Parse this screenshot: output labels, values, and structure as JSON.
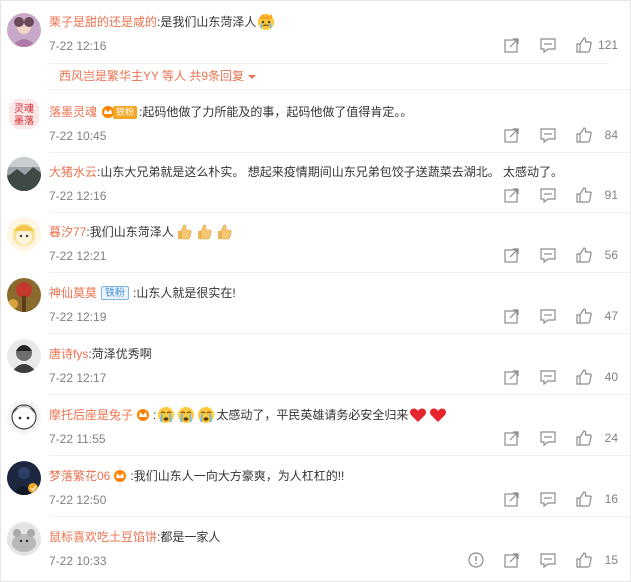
{
  "comments": [
    {
      "user": "栗子是甜的还是咸的",
      "text": "是我们山东菏泽人",
      "time": "7-22 12:16",
      "likes": "121"
    },
    {
      "user": "落墨灵魂",
      "badge": "铁粉",
      "text": "起码他做了力所能及的事，起码他做了值得肯定。。",
      "time": "7-22 10:45",
      "likes": "84"
    },
    {
      "user": "大猪水云",
      "text": "山东大兄弟就是这么朴实。 想起来疫情期间山东兄弟包饺子送蔬菜去湖北。 太感动了。",
      "time": "7-22 12:16",
      "likes": "91"
    },
    {
      "user": "暮汐77",
      "text": "我们山东菏泽人",
      "time": "7-22 12:21",
      "likes": "56"
    },
    {
      "user": "神仙莫莫",
      "badge": "铁粉",
      "text": "山东人就是很实在!",
      "time": "7-22 12:19",
      "likes": "47"
    },
    {
      "user": "唐诗fys",
      "text": "菏泽优秀啊",
      "time": "7-22 12:17",
      "likes": "40"
    },
    {
      "user": "摩托后座是兔子",
      "text": "太感动了，平民英雄请务必安全归来",
      "time": "7-22 11:55",
      "likes": "24"
    },
    {
      "user": "梦落繁花06",
      "text": "我们山东人一向大方豪爽，为人杠杠的!!",
      "time": "7-22 12:50",
      "likes": "16"
    },
    {
      "user": "鼠标喜欢吃土豆馅饼",
      "text": "都是一家人",
      "time": "7-22 10:33",
      "likes": "15"
    }
  ],
  "replies_summary": {
    "name": "西风岂是繁华主YY",
    "text": "等人 共9条回复"
  },
  "icons": {
    "share": "share-icon",
    "comment": "comment-icon",
    "like": "thumbs-up-icon",
    "report": "report-icon"
  },
  "colors": {
    "username": "#eb7350",
    "meta": "#808080",
    "heart": "#e6252c"
  }
}
